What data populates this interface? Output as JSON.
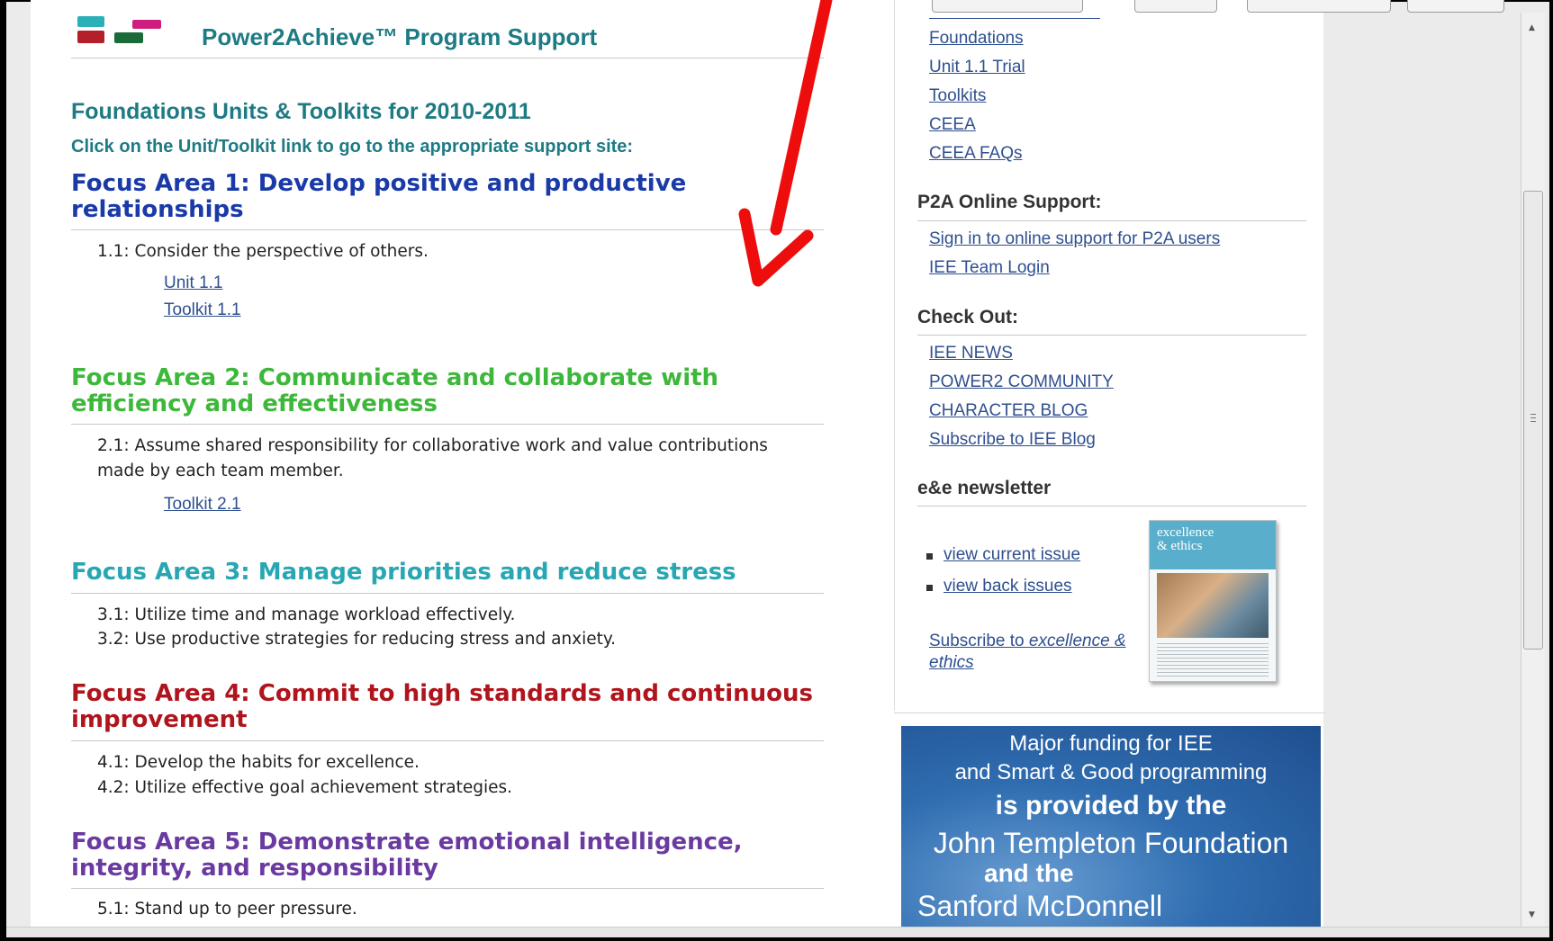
{
  "header": {
    "site_title": "Power2Achieve™ Program Support"
  },
  "main": {
    "heading": "Foundations Units & Toolkits for 2010-2011",
    "instruction": "Click on the Unit/Toolkit link to go to the appropriate support site:",
    "focus_areas": [
      {
        "title": "Focus Area 1: Develop positive and productive relationships",
        "color": "#1a3aa8",
        "items": [
          "1.1: Consider the perspective of others."
        ],
        "links": [
          "Unit 1.1",
          "Toolkit 1.1"
        ]
      },
      {
        "title": "Focus Area 2: Communicate and collaborate with efficiency and effectiveness",
        "color": "#3db83a",
        "items": [
          "2.1: Assume shared responsibility for collaborative work and value contributions made by each team member."
        ],
        "links": [
          "Toolkit 2.1"
        ]
      },
      {
        "title": "Focus Area 3: Manage priorities and reduce stress",
        "color": "#28a7b3",
        "items": [
          "3.1: Utilize time and manage workload effectively.",
          "3.2: Use productive strategies for reducing stress and anxiety."
        ],
        "links": []
      },
      {
        "title": "Focus Area 4: Commit to high standards and continuous improvement",
        "color": "#b0141c",
        "items": [
          "4.1: Develop the habits for excellence.",
          "4.2: Utilize effective goal achievement strategies."
        ],
        "links": []
      },
      {
        "title": "Focus Area 5: Demonstrate emotional intelligence, integrity, and responsibility",
        "color": "#6a3aa0",
        "items": [
          "5.1: Stand up to peer pressure."
        ],
        "links": []
      }
    ]
  },
  "sidebar": {
    "top_links": [
      "Foundations",
      "Unit 1.1 Trial",
      "Toolkits",
      "CEEA",
      "CEEA FAQs"
    ],
    "online_support": {
      "heading": "P2A Online Support:",
      "links": [
        "Sign in to online support for P2A users",
        "IEE Team Login"
      ]
    },
    "check_out": {
      "heading": "Check Out:",
      "links": [
        "IEE NEWS",
        "POWER2 COMMUNITY",
        "CHARACTER BLOG",
        "Subscribe to IEE Blog"
      ]
    },
    "newsletter": {
      "heading": "e&e newsletter",
      "links": [
        "view current issue",
        "view back issues"
      ],
      "subscribe_prefix": "Subscribe to ",
      "subscribe_italic": "excellence & ethics",
      "magazine_title_line1": "excellence",
      "magazine_title_line2": "& ethics"
    },
    "funding": {
      "line1": "Major funding for IEE",
      "line2": "and Smart & Good programming",
      "line3": "is provided by the",
      "line4": "John Templeton Foundation",
      "line5": "and the",
      "line6": "Sanford McDonnell"
    }
  },
  "annotation": {
    "arrow_color": "#ee0d0d"
  }
}
